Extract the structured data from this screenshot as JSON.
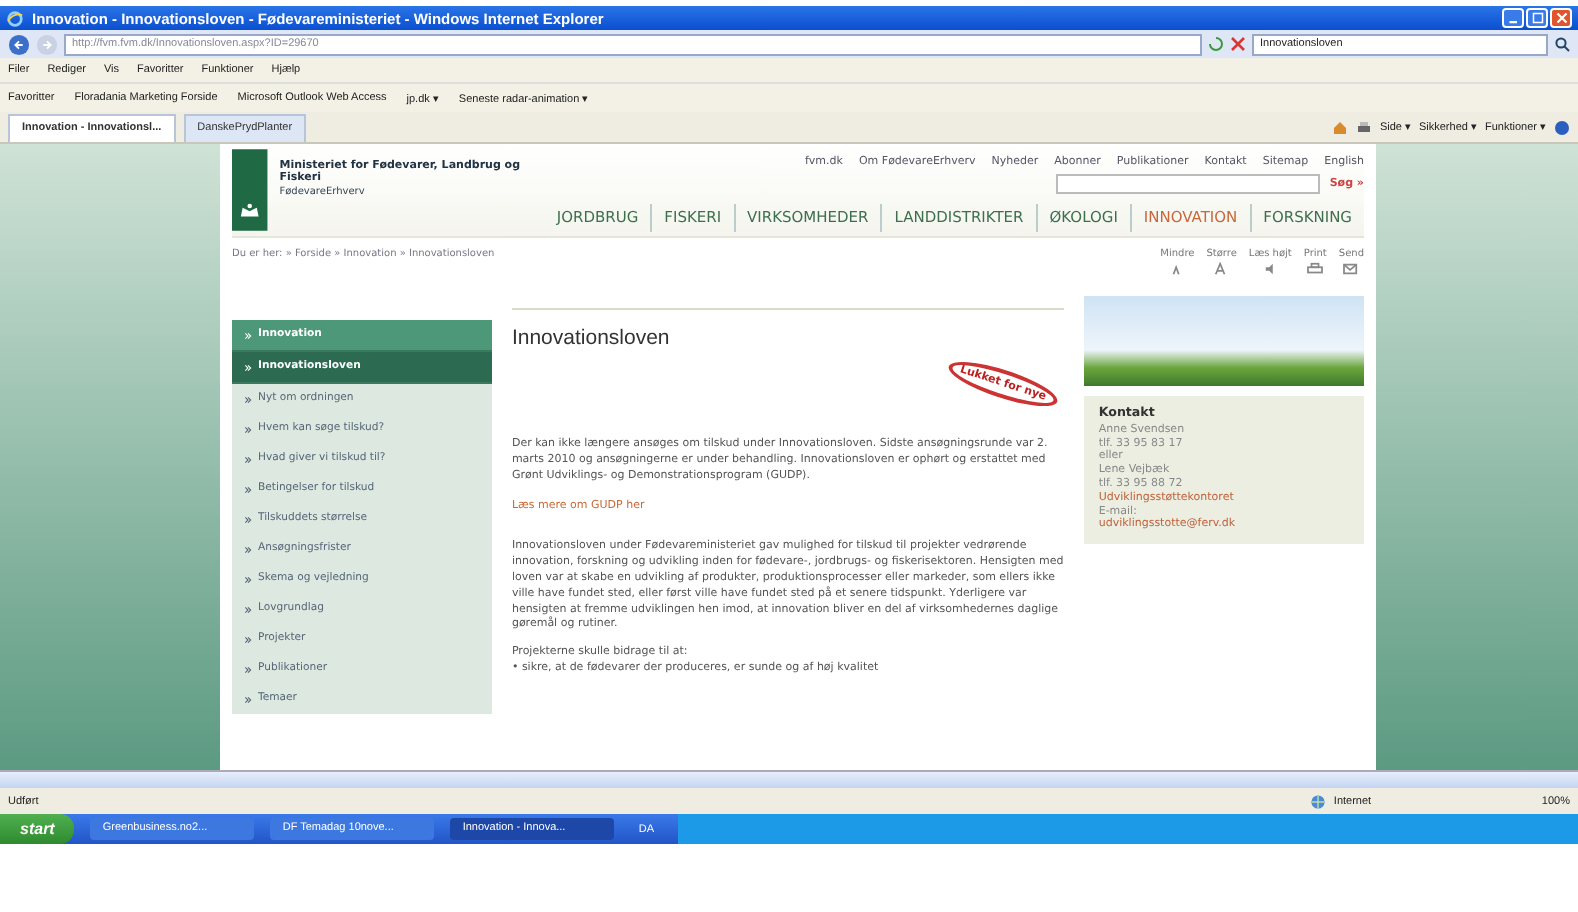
{
  "window": {
    "title": "Innovation - Innovationsloven - Fødevareministeriet - Windows Internet Explorer"
  },
  "address_bar": {
    "url": "http://fvm.fvm.dk/Innovationsloven.aspx?ID=29670",
    "search": "Innovationsloven"
  },
  "menu": [
    "Filer",
    "Rediger",
    "Vis",
    "Favoritter",
    "Funktioner",
    "Hjælp"
  ],
  "favorites_bar": {
    "label": "Favoritter",
    "links": [
      "Floradania Marketing Forside",
      "Microsoft Outlook Web Access",
      "jp.dk ▾",
      "Seneste radar-animation ▾"
    ]
  },
  "tabs": [
    {
      "label": "Innovation - Innovationsl...",
      "selected": true
    },
    {
      "label": "DanskePrydPlanter",
      "selected": false
    }
  ],
  "command_bar": [
    "Side ▾",
    "Sikkerhed ▾",
    "Funktioner ▾"
  ],
  "page": {
    "org": "Ministeriet for Fødevarer, Landbrug og Fiskeri",
    "unit": "FødevareErhverv",
    "top_links": [
      "fvm.dk",
      "Om FødevareErhverv",
      "Nyheder",
      "Abonner",
      "Publikationer",
      "Kontakt",
      "Sitemap",
      "English"
    ],
    "search_button": "Søg »",
    "nav": [
      {
        "label": "JORDBRUG",
        "selected": false
      },
      {
        "label": "FISKERI",
        "selected": false
      },
      {
        "label": "VIRKSOMHEDER",
        "selected": false
      },
      {
        "label": "LANDDISTRIKTER",
        "selected": false
      },
      {
        "label": "ØKOLOGI",
        "selected": false
      },
      {
        "label": "INNOVATION",
        "selected": true
      },
      {
        "label": "FORSKNING",
        "selected": false
      }
    ],
    "breadcrumb": "Du er her: » Forside » Innovation » Innovationsloven",
    "tools": [
      {
        "label": "Mindre",
        "kind": "smaller"
      },
      {
        "label": "Større",
        "kind": "larger"
      },
      {
        "label": "Læs højt",
        "kind": "speak"
      },
      {
        "label": "Print",
        "kind": "print"
      },
      {
        "label": "Send",
        "kind": "send"
      }
    ],
    "sidebar": [
      {
        "label": "Innovation",
        "kind": "section",
        "selected": false
      },
      {
        "label": "Innovationsloven",
        "kind": "section",
        "selected": true
      },
      {
        "label": "Nyt om ordningen",
        "kind": "link",
        "selected": false
      },
      {
        "label": "Hvem kan søge tilskud?",
        "kind": "link",
        "selected": false
      },
      {
        "label": "Hvad giver vi tilskud til?",
        "kind": "link",
        "selected": false
      },
      {
        "label": "Betingelser for tilskud",
        "kind": "link",
        "selected": false
      },
      {
        "label": "Tilskuddets størrelse",
        "kind": "link",
        "selected": false
      },
      {
        "label": "Ansøgningsfrister",
        "kind": "link",
        "selected": false
      },
      {
        "label": "Skema og vejledning",
        "kind": "link",
        "selected": false
      },
      {
        "label": "Lovgrundlag",
        "kind": "link",
        "selected": false
      },
      {
        "label": "Projekter",
        "kind": "link",
        "selected": false
      },
      {
        "label": "Publikationer",
        "kind": "link",
        "selected": false
      },
      {
        "label": "Temaer",
        "kind": "link",
        "selected": false
      }
    ],
    "title": "Innovationsloven",
    "stamp": "Lukket for nye",
    "intro": "Der kan ikke længere ansøges om tilskud under Innovationsloven. Sidste ansøgningsrunde var 2. marts 2010 og ansøgningerne er under behandling. Innovationsloven er ophørt og erstattet med Grønt Udviklings- og Demonstrationsprogram (GUDP).",
    "link": "Læs mere om GUDP her",
    "body": "Innovationsloven under Fødevareministeriet gav mulighed for tilskud til projekter vedrørende innovation, forskning og udvikling inden for fødevare-, jordbrugs- og fiskerisektoren. Hensigten med loven var at skabe en udvikling af produkter, produktionsprocesser eller markeder, som ellers ikke ville have fundet sted, eller først ville have fundet sted på et senere tidspunkt. Yderligere var hensigten at fremme udviklingen hen imod, at innovation bliver en del af virksomhedernes daglige gøremål og rutiner.",
    "goals_intro": "Projekterne skulle bidrage til at:",
    "goals": [
      "• sikre, at de fødevarer der produceres, er sunde og af høj kvalitet"
    ],
    "contact": {
      "heading": "Kontakt",
      "lines": [
        {
          "text": "Anne Svendsen",
          "kind": "text"
        },
        {
          "text": "tlf. 33 95 83 17",
          "kind": "text"
        },
        {
          "text": "eller",
          "kind": "text"
        },
        {
          "text": "Lene Vejbæk",
          "kind": "text"
        },
        {
          "text": "tlf. 33 95 88 72",
          "kind": "text"
        },
        {
          "text": "Udviklingsstøttekontoret",
          "kind": "link"
        },
        {
          "text": "E-mail:",
          "kind": "text"
        },
        {
          "text": "udviklingsstotte@ferv.dk",
          "kind": "link"
        }
      ]
    }
  },
  "status_bar": {
    "text": "Udført",
    "zone": "Internet",
    "zoom": "100%"
  },
  "taskbar": {
    "start": "start",
    "tasks": [
      {
        "label": "Greenbusiness.no2...",
        "selected": false
      },
      {
        "label": "DF Temadag 10nove...",
        "selected": false
      },
      {
        "label": "Innovation - Innova...",
        "selected": true
      }
    ],
    "language": "DA"
  }
}
